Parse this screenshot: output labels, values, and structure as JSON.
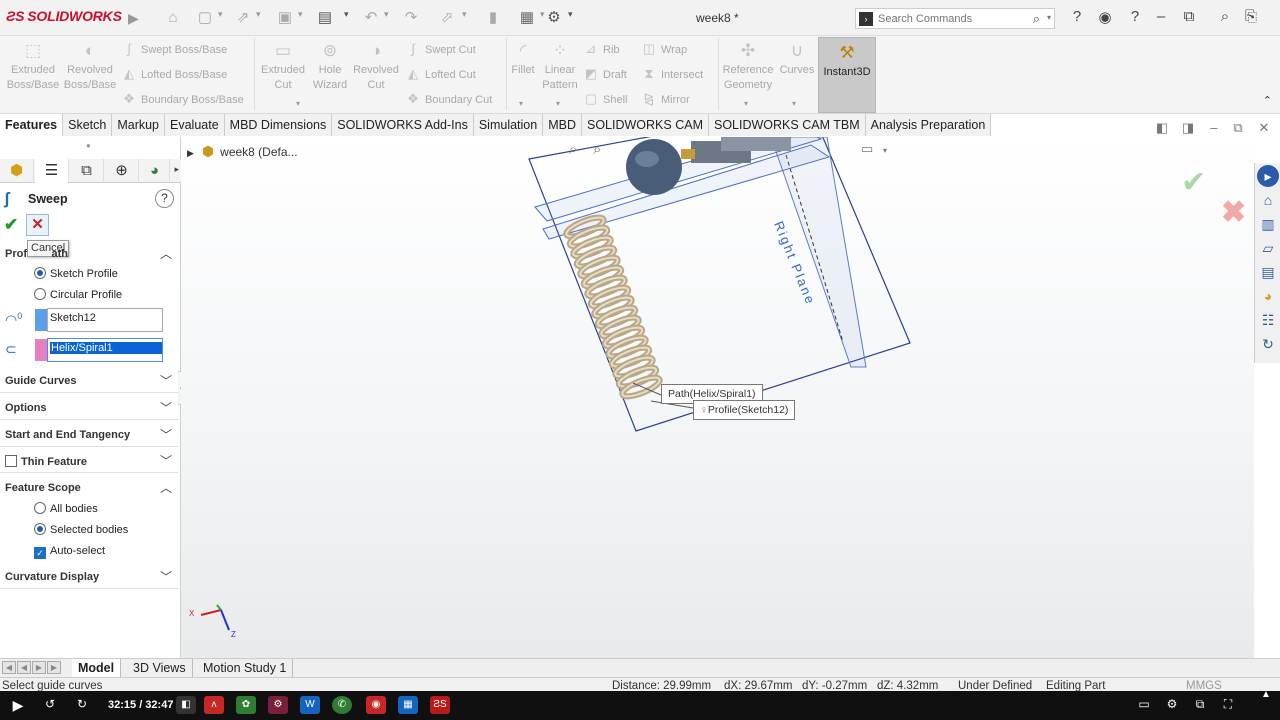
{
  "app": {
    "brand": "SOLIDWORKS",
    "doc_title": "week8 *"
  },
  "search": {
    "placeholder": "Search Commands"
  },
  "ribbon": {
    "extruded_boss": "Extruded Boss/Base",
    "revolved_boss": "Revolved Boss/Base",
    "swept_boss": "Swept Boss/Base",
    "lofted_boss": "Lofted Boss/Base",
    "boundary_boss": "Boundary Boss/Base",
    "extruded_cut": "Extruded Cut",
    "hole_wizard": "Hole Wizard",
    "revolved_cut": "Revolved Cut",
    "swept_cut": "Swept Cut",
    "lofted_cut": "Lofted Cut",
    "boundary_cut": "Boundary Cut",
    "fillet": "Fillet",
    "linear_pattern": "Linear Pattern",
    "rib": "Rib",
    "draft": "Draft",
    "shell": "Shell",
    "wrap": "Wrap",
    "intersect": "Intersect",
    "mirror": "Mirror",
    "reference_geometry": "Reference Geometry",
    "curves": "Curves",
    "instant3d": "Instant3D"
  },
  "cm_tabs": [
    "Features",
    "Sketch",
    "Markup",
    "Evaluate",
    "MBD Dimensions",
    "SOLIDWORKS Add-Ins",
    "Simulation",
    "MBD",
    "SOLIDWORKS CAM",
    "SOLIDWORKS CAM TBM",
    "Analysis Preparation"
  ],
  "property_manager": {
    "title": "Sweep",
    "help": "?",
    "cancel_tooltip": "Cancel",
    "profile_path": {
      "label": "Prof        ath",
      "sketch_profile": "Sketch Profile",
      "circular_profile": "Circular Profile",
      "profile_value": "Sketch12",
      "path_value": "Helix/Spiral1",
      "profile_index": "0"
    },
    "guide_curves": "Guide Curves",
    "options": "Options",
    "tangency": "Start and End Tangency",
    "thin_feature": "Thin Feature",
    "feature_scope": {
      "label": "Feature Scope",
      "all_bodies": "All bodies",
      "selected_bodies": "Selected bodies",
      "auto_select": "Auto-select"
    },
    "curvature_display": "Curvature Display"
  },
  "viewport": {
    "tree_root": "week8  (Defa...",
    "plane_label": "Right Plane",
    "path_callout": "Path(Helix/Spiral1)",
    "profile_callout": "Profile(Sketch12)",
    "triad_x": "X",
    "triad_z": "Z"
  },
  "bottom_tabs": [
    "Model",
    "3D Views",
    "Motion Study 1"
  ],
  "status": {
    "message": "Select guide curves",
    "distance": "Distance: 29.99mm",
    "dx": "dX: 29.67mm",
    "dy": "dY: -0.27mm",
    "dz": "dZ: 4.32mm",
    "state": "Under Defined",
    "mode": "Editing Part",
    "units": "MMGS"
  },
  "player": {
    "time": "32:15 / 32:47"
  }
}
